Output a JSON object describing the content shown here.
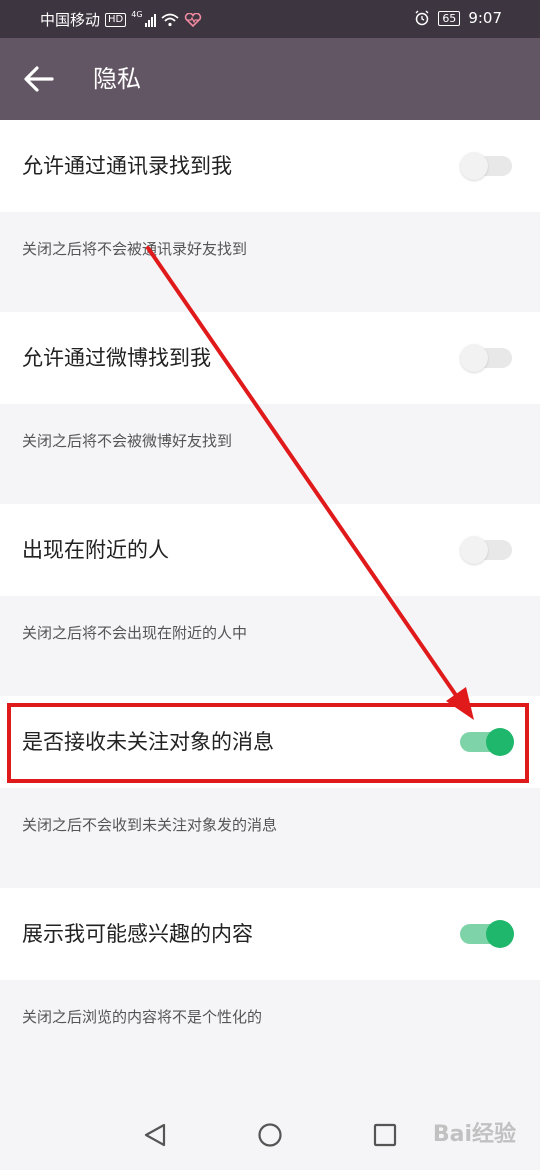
{
  "status_bar": {
    "carrier": "中国移动",
    "network_badge": "HD",
    "network_type": "4G",
    "battery": "65",
    "time": "9:07",
    "icons": [
      "signal-icon",
      "wifi-icon",
      "health-icon",
      "alarm-icon",
      "battery-icon"
    ]
  },
  "app_bar": {
    "title": "隐私",
    "back_icon": "arrow-left-icon"
  },
  "settings": [
    {
      "label": "允许通过通讯录找到我",
      "description": "关闭之后将不会被通讯录好友找到",
      "enabled": false
    },
    {
      "label": "允许通过微博找到我",
      "description": "关闭之后将不会被微博好友找到",
      "enabled": false
    },
    {
      "label": "出现在附近的人",
      "description": "关闭之后将不会出现在附近的人中",
      "enabled": false
    },
    {
      "label": "是否接收未关注对象的消息",
      "description": "关闭之后不会收到未关注对象发的消息",
      "enabled": true
    },
    {
      "label": "展示我可能感兴趣的内容",
      "description": "关闭之后浏览的内容将不是个性化的",
      "enabled": true
    }
  ],
  "annotation": {
    "color": "#e0191b"
  },
  "colors": {
    "app_bar": "#635664",
    "status_bar": "#3d3540",
    "toggle_on": "#1fb76b"
  },
  "navigation_bar": {
    "icons": [
      "back-triangle-icon",
      "home-circle-icon",
      "recents-square-icon"
    ]
  },
  "watermark": "Bai经验"
}
